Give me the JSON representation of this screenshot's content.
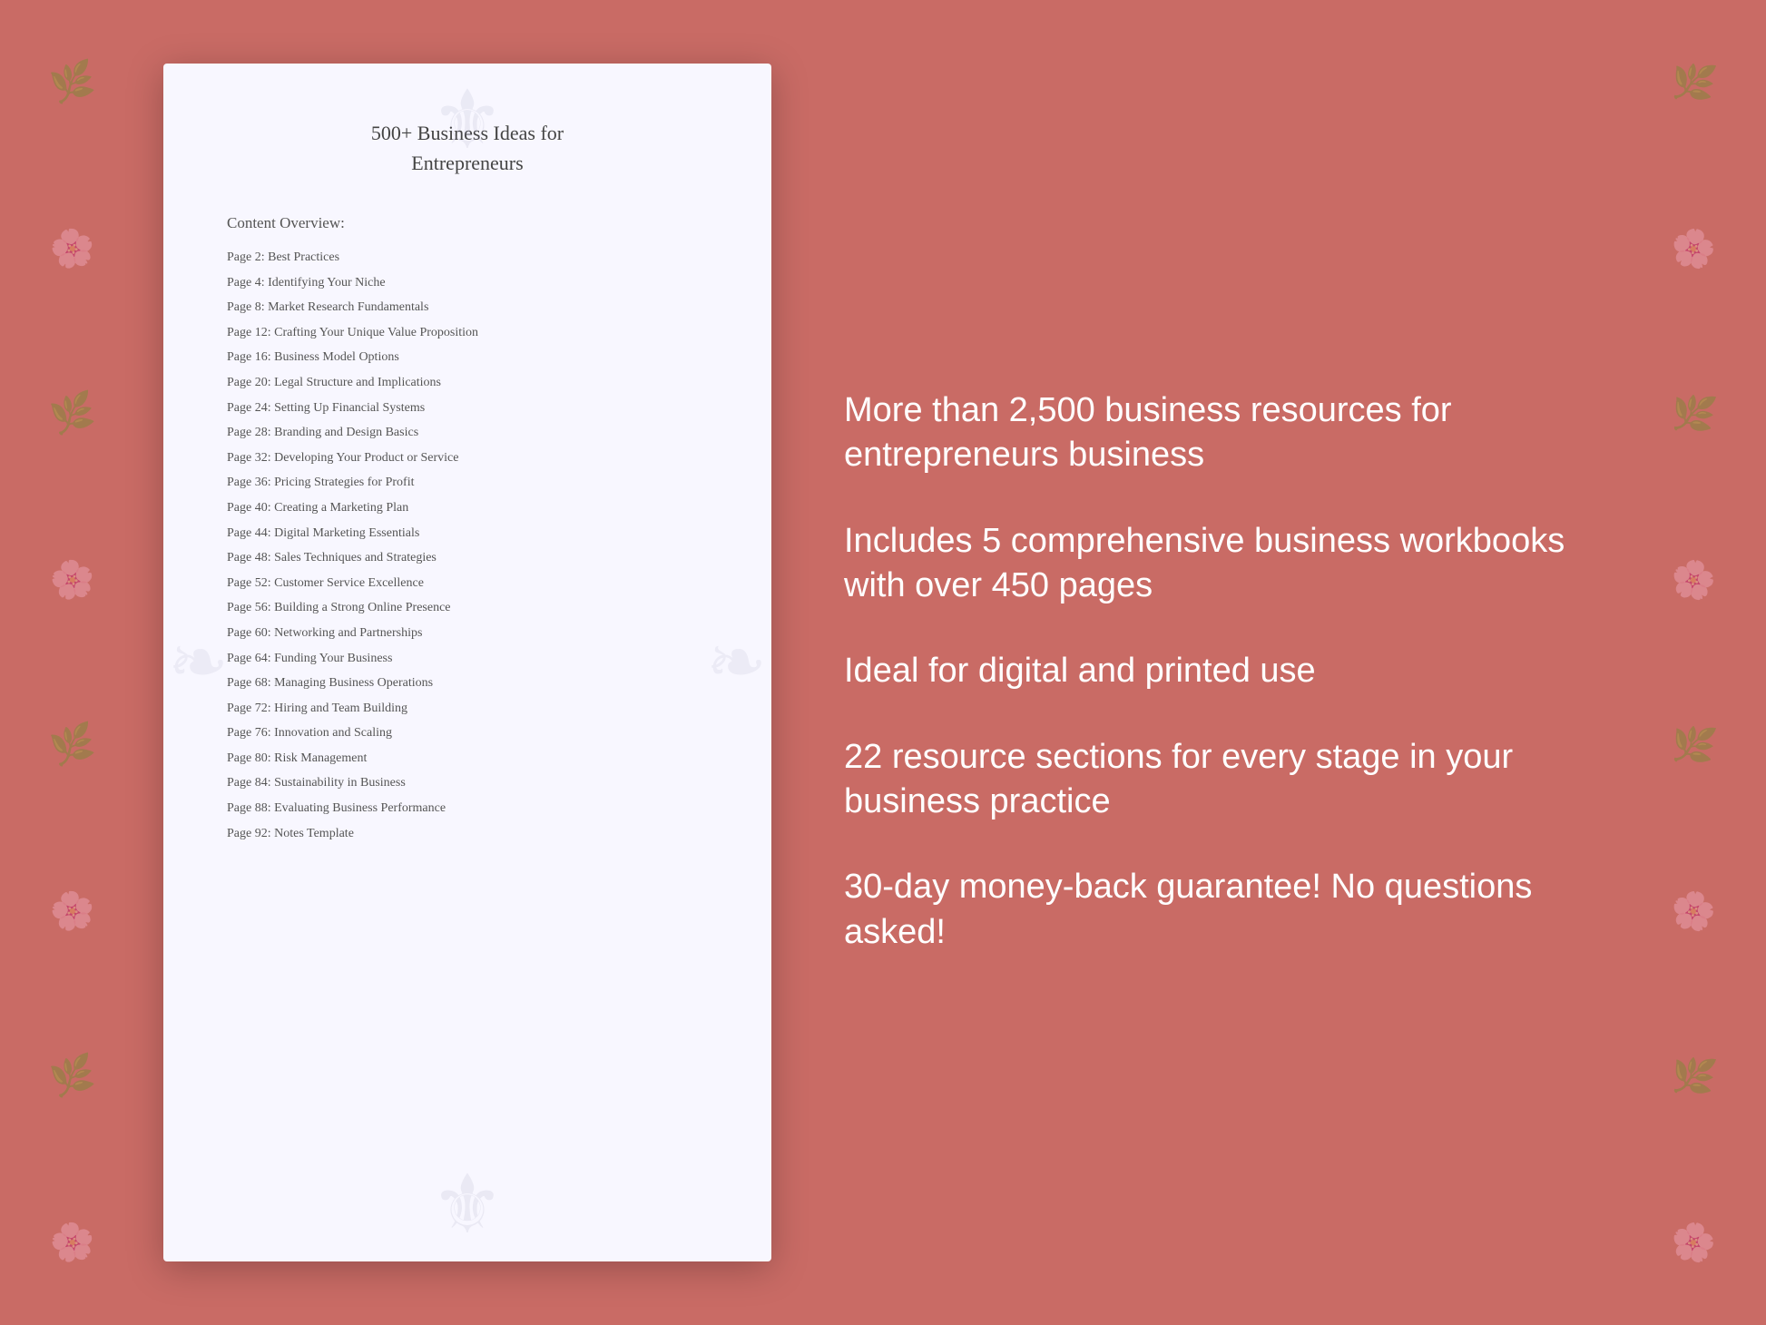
{
  "background_color": "#c96b65",
  "document": {
    "title_line1": "500+ Business Ideas for",
    "title_line2": "Entrepreneurs",
    "section_title": "Content Overview:",
    "toc_items": [
      {
        "page": "Page  2:",
        "title": "Best Practices"
      },
      {
        "page": "Page  4:",
        "title": "Identifying Your Niche"
      },
      {
        "page": "Page  8:",
        "title": "Market Research Fundamentals"
      },
      {
        "page": "Page 12:",
        "title": "Crafting Your Unique Value Proposition"
      },
      {
        "page": "Page 16:",
        "title": "Business Model Options"
      },
      {
        "page": "Page 20:",
        "title": "Legal Structure and Implications"
      },
      {
        "page": "Page 24:",
        "title": "Setting Up Financial Systems"
      },
      {
        "page": "Page 28:",
        "title": "Branding and Design Basics"
      },
      {
        "page": "Page 32:",
        "title": "Developing Your Product or Service"
      },
      {
        "page": "Page 36:",
        "title": "Pricing Strategies for Profit"
      },
      {
        "page": "Page 40:",
        "title": "Creating a Marketing Plan"
      },
      {
        "page": "Page 44:",
        "title": "Digital Marketing Essentials"
      },
      {
        "page": "Page 48:",
        "title": "Sales Techniques and Strategies"
      },
      {
        "page": "Page 52:",
        "title": "Customer Service Excellence"
      },
      {
        "page": "Page 56:",
        "title": "Building a Strong Online Presence"
      },
      {
        "page": "Page 60:",
        "title": "Networking and Partnerships"
      },
      {
        "page": "Page 64:",
        "title": "Funding Your Business"
      },
      {
        "page": "Page 68:",
        "title": "Managing Business Operations"
      },
      {
        "page": "Page 72:",
        "title": "Hiring and Team Building"
      },
      {
        "page": "Page 76:",
        "title": "Innovation and Scaling"
      },
      {
        "page": "Page 80:",
        "title": "Risk Management"
      },
      {
        "page": "Page 84:",
        "title": "Sustainability in Business"
      },
      {
        "page": "Page 88:",
        "title": "Evaluating Business Performance"
      },
      {
        "page": "Page 92:",
        "title": "Notes Template"
      }
    ]
  },
  "features": [
    "More than 2,500 business resources for entrepreneurs business",
    "Includes 5 comprehensive business workbooks with over 450 pages",
    "Ideal for digital and printed use",
    "22 resource sections for every stage in your business practice",
    "30-day money-back guarantee! No questions asked!"
  ]
}
